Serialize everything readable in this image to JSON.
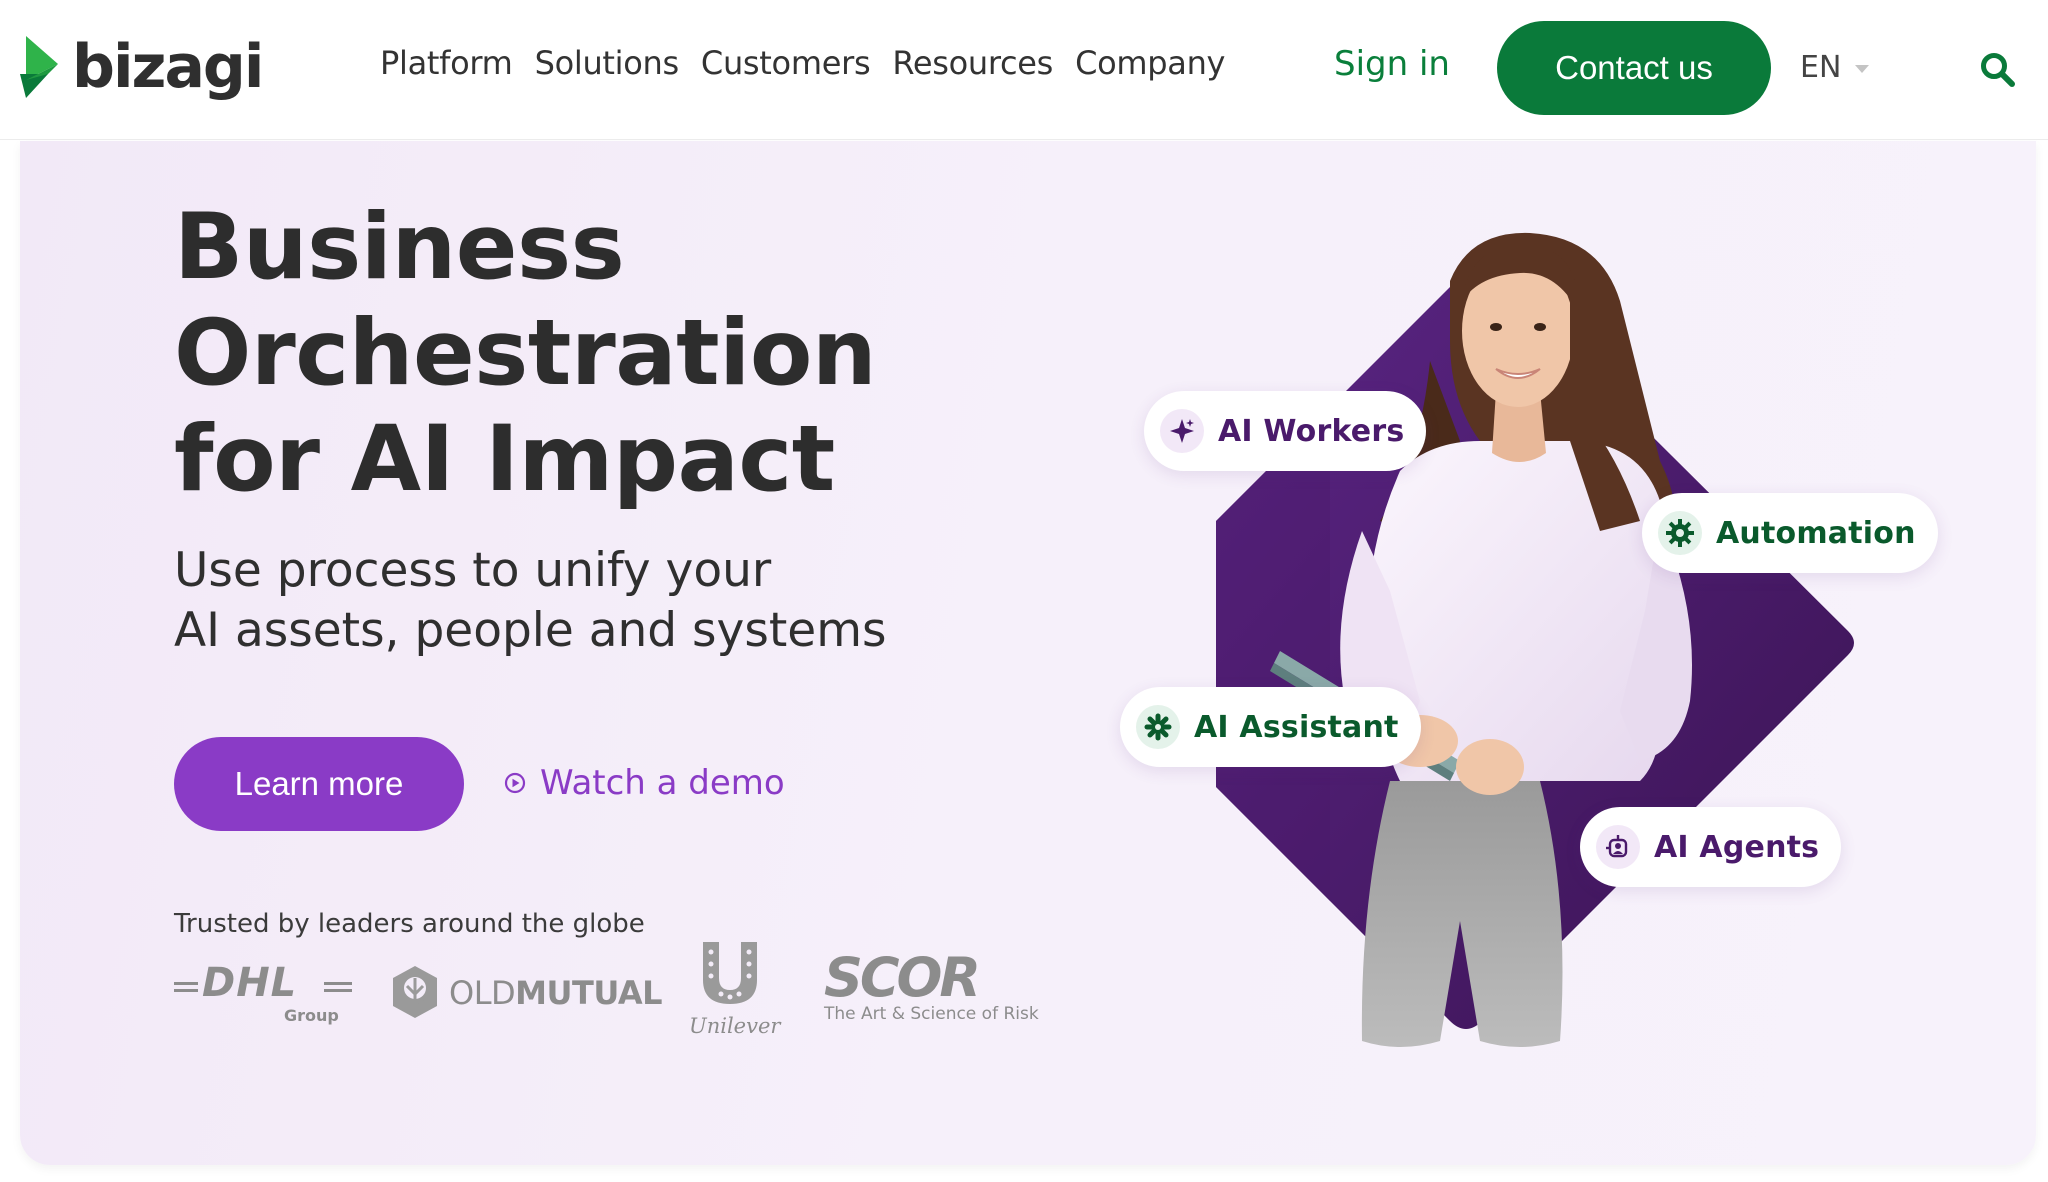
{
  "brand": {
    "name": "bizagi",
    "accent_green": "#0a7a3a",
    "accent_purple": "#8a3bc6"
  },
  "nav": {
    "items": [
      {
        "label": "Platform"
      },
      {
        "label": "Solutions"
      },
      {
        "label": "Customers"
      },
      {
        "label": "Resources"
      },
      {
        "label": "Company"
      }
    ],
    "signin_label": "Sign in",
    "contact_label": "Contact us",
    "language": "EN",
    "search_icon": "search-icon"
  },
  "hero": {
    "headline_lines": [
      "Business",
      "Orchestration",
      "for AI Impact"
    ],
    "subhead_lines": [
      "Use process to unify your",
      "AI assets, people and systems"
    ],
    "learn_more_label": "Learn more",
    "watch_demo_label": "Watch a demo",
    "trusted_label": "Trusted by leaders around the globe",
    "client_logos": [
      {
        "name": "DHL",
        "sub": "Group"
      },
      {
        "name": "OLDMUTUAL",
        "prefix": "OLD",
        "suffix": "MUTUAL"
      },
      {
        "name": "Unilever"
      },
      {
        "name": "SCOR",
        "tagline": "The Art & Science of Risk"
      }
    ]
  },
  "capabilities": [
    {
      "label": "AI Workers",
      "icon": "sparkle-icon",
      "color": "#4a1a6b"
    },
    {
      "label": "Automation",
      "icon": "gear-icon",
      "color": "#0a5a2c"
    },
    {
      "label": "AI Assistant",
      "icon": "asterisk-icon",
      "color": "#0a5a2c"
    },
    {
      "label": "AI Agents",
      "icon": "agent-icon",
      "color": "#4a1a6b"
    }
  ]
}
